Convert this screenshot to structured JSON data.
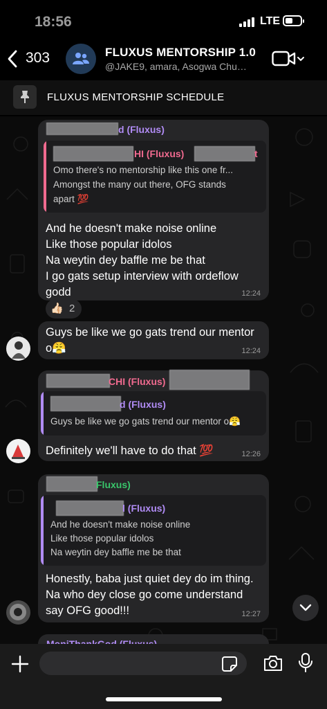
{
  "status": {
    "time": "18:56",
    "network": "LTE"
  },
  "header": {
    "back_count": "303",
    "title": "FLUXUS MENTORSHIP 1.0",
    "subtitle": "@JAKE9, amara, Asogwa Chu…"
  },
  "pinned": {
    "text": "FLUXUS MENTORSHIP SCHEDULE"
  },
  "messages": [
    {
      "sender": "d (Fluxus)",
      "sender_color": "#b18cf5",
      "quote": {
        "name": "HI (Fluxus)",
        "name_color": "#f06a8f",
        "name_suffix": "t",
        "lines": [
          "Omo there's no mentorship like this one fr...",
          "Amongst the many out there, OFG stands",
          "apart 💯"
        ]
      },
      "body": [
        "And he doesn't make noise online",
        "Like those popular idolos",
        "Na weytin dey baffle me be that",
        "I go gats setup interview with ordeflow",
        "godd"
      ],
      "time": "12:24",
      "reaction": {
        "emoji": "👍🏻",
        "count": "2"
      }
    },
    {
      "body": [
        "Guys be like we go gats trend our mentor",
        "o😤"
      ],
      "time": "12:24"
    },
    {
      "sender": "CHI (Fluxus)",
      "sender_color": "#f06a8f",
      "quote": {
        "name": "d (Fluxus)",
        "name_color": "#b18cf5",
        "lines": [
          "Guys be like we go gats trend our mentor o😤"
        ]
      },
      "body": [
        "Definitely we'll have to do that 💯"
      ],
      "time": "12:26"
    },
    {
      "sender": "Fluxus)",
      "sender_color": "#39c66b",
      "quote": {
        "name": "l (Fluxus)",
        "name_color": "#b18cf5",
        "lines": [
          "And he doesn't make noise online",
          "Like those popular idolos",
          "Na weytin dey baffle me be that"
        ]
      },
      "body": [
        "Honestly, baba just quiet dey do im thing.",
        "Na who dey close go come understand",
        "say OFG good!!!"
      ],
      "time": "12:27"
    }
  ],
  "partial_sender": "MoniThankGod (Fluxus)",
  "colors": {
    "accent_purple": "#b18cf5",
    "accent_pink": "#f06a8f",
    "accent_green": "#39c66b",
    "bubble": "#262628"
  }
}
